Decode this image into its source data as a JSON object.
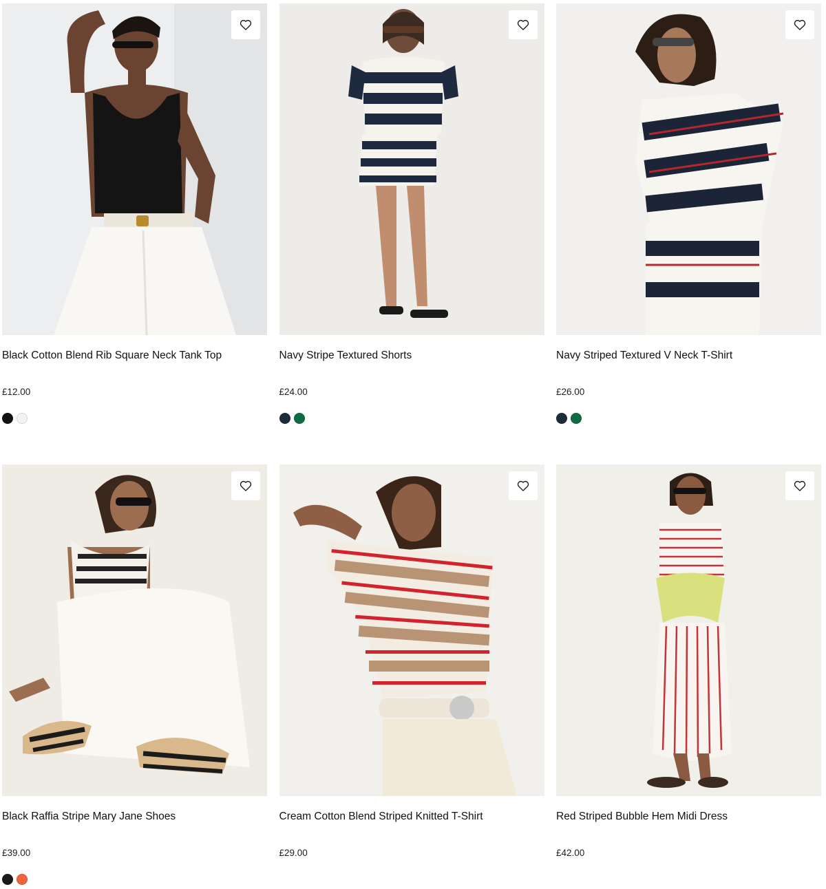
{
  "products": [
    {
      "name": "Black Cotton Blend Rib Square Neck Tank Top",
      "price": "£12.00",
      "swatches": [
        "#111111",
        "#eef4f6"
      ],
      "image_label": "model wearing black rib tank top and white trousers"
    },
    {
      "name": "Navy Stripe Textured Shorts",
      "price": "£24.00",
      "swatches": [
        "#1f2a3c",
        "#0f6b44"
      ],
      "image_label": "model wearing navy and white striped top and shorts"
    },
    {
      "name": "Navy Striped Textured V Neck T-Shirt",
      "price": "£26.00",
      "swatches": [
        "#1f2a3c",
        "#0f6b44"
      ],
      "image_label": "model wearing navy striped v neck t-shirt"
    },
    {
      "name": "Black Raffia Stripe Mary Jane Shoes",
      "price": "£39.00",
      "swatches": [
        "#1a1a1a",
        "#f0643c"
      ],
      "image_label": "model seated wearing raffia stripe mary jane shoes"
    },
    {
      "name": "Cream Cotton Blend Striped Knitted T-Shirt",
      "price": "£29.00",
      "swatches": [],
      "image_label": "model wearing cream and red striped knitted t-shirt"
    },
    {
      "name": "Red Striped Bubble Hem Midi Dress",
      "price": "£42.00",
      "swatches": [],
      "image_label": "model wearing red striped bubble hem midi dress"
    }
  ]
}
